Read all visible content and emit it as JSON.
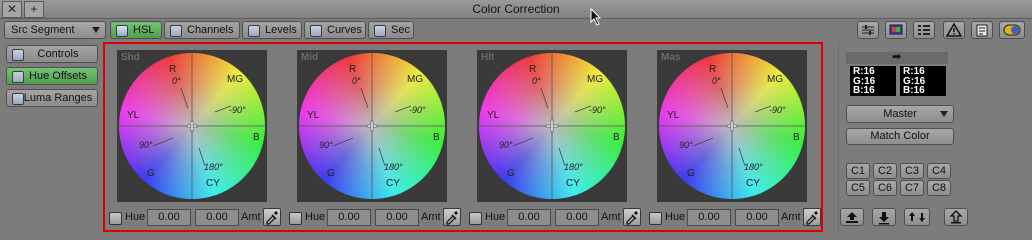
{
  "window": {
    "title": "Color Correction",
    "close_label": "✕",
    "add_label": "+"
  },
  "toolbar": {
    "source_dropdown": "Src Segment",
    "tabs": [
      {
        "label": "HSL",
        "active": true
      },
      {
        "label": "Channels",
        "active": false
      },
      {
        "label": "Levels",
        "active": false
      },
      {
        "label": "Curves",
        "active": false
      },
      {
        "label": "Sec",
        "active": false
      }
    ],
    "right_icons": [
      "sliders-icon",
      "color-display-icon",
      "list-settings-icon",
      "warning-icon",
      "clipboard-icon",
      "toggle-icon"
    ]
  },
  "left_panel": {
    "buttons": [
      {
        "label": "Controls",
        "active": false
      },
      {
        "label": "Hue Offsets",
        "active": true
      },
      {
        "label": "Luma Ranges",
        "active": false
      }
    ]
  },
  "wheels": [
    {
      "name": "Shd",
      "hue_label": "Hue",
      "value1": "0.00",
      "value2": "0.00",
      "amt_label": "Amt"
    },
    {
      "name": "Mid",
      "hue_label": "Hue",
      "value1": "0.00",
      "value2": "0.00",
      "amt_label": "Amt"
    },
    {
      "name": "Hlt",
      "hue_label": "Hue",
      "value1": "0.00",
      "value2": "0.00",
      "amt_label": "Amt"
    },
    {
      "name": "Mas",
      "hue_label": "Hue",
      "value1": "0.00",
      "value2": "0.00",
      "amt_label": "Amt"
    }
  ],
  "wheel_markers": {
    "r": "R",
    "mg": "MG",
    "yl": "YL",
    "b": "B",
    "g": "G",
    "cy": "CY",
    "deg0": "0°",
    "degm90": "-90°",
    "deg90": "90°",
    "deg180": "180°"
  },
  "right_panel": {
    "swatch_left": {
      "r": "R:16",
      "g": "G:16",
      "b": "B:16"
    },
    "swatch_right": {
      "r": "R:16",
      "g": "G:16",
      "b": "B:16"
    },
    "swatch_arrow": "➡",
    "mode_dropdown": "Master",
    "match_button": "Match Color",
    "color_buttons": [
      "C1",
      "C2",
      "C3",
      "C4",
      "C5",
      "C6",
      "C7",
      "C8"
    ],
    "bottom_icons": [
      "stack-up-icon",
      "down-arrow-icon",
      "stack-swap-icon",
      "up-arrow-icon"
    ]
  }
}
